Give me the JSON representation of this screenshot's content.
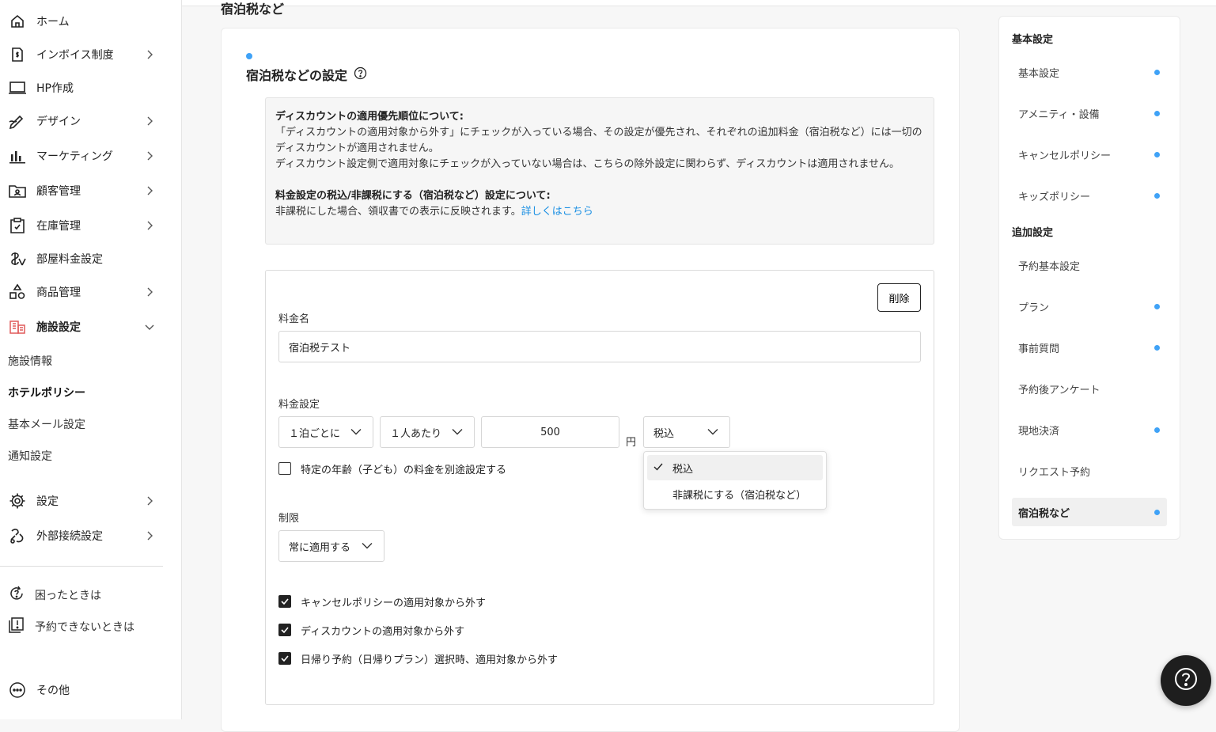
{
  "sidebar": {
    "items": [
      {
        "label": "ホーム",
        "icon": "home-icon",
        "has_chevron": false
      },
      {
        "label": "インボイス制度",
        "icon": "invoice-icon",
        "has_chevron": true
      },
      {
        "label": "HP作成",
        "icon": "laptop-icon",
        "has_chevron": false
      },
      {
        "label": "デザイン",
        "icon": "pen-icon",
        "has_chevron": true
      },
      {
        "label": "マーケティング",
        "icon": "bar-chart-icon",
        "has_chevron": true
      },
      {
        "label": "顧客管理",
        "icon": "folder-user-icon",
        "has_chevron": true
      },
      {
        "label": "在庫管理",
        "icon": "clipboard-check-icon",
        "has_chevron": true
      },
      {
        "label": "部屋料金設定",
        "icon": "yen-icon",
        "has_chevron": false
      },
      {
        "label": "商品管理",
        "icon": "shapes-icon",
        "has_chevron": true
      },
      {
        "label": "施設設定",
        "icon": "building-icon",
        "has_chevron": true,
        "expanded": true
      }
    ],
    "subitems": [
      "施設情報",
      "ホテルポリシー",
      "基本メール設定",
      "通知設定"
    ],
    "settings_items": [
      {
        "label": "設定",
        "icon": "gear-icon"
      },
      {
        "label": "外部接続設定",
        "icon": "link-icon"
      }
    ],
    "help_items": [
      {
        "label": "困ったときは",
        "icon": "help-refresh-icon"
      },
      {
        "label": "予約できないときは",
        "icon": "alert-book-icon"
      }
    ],
    "other_label": "その他"
  },
  "section_heading": "宿泊税など",
  "card": {
    "title": "宿泊税などの設定",
    "info": {
      "heading1": "ディスカウントの適用優先順位について:",
      "line1": "「ディスカウントの適用対象から外す」にチェックが入っている場合、その設定が優先され、それぞれの追加料金（宿泊税など）には一切のディスカウントが適用されません。",
      "line2": "ディスカウント設定側で適用対象にチェックが入っていない場合は、こちらの除外設定に関わらず、ディスカウントは適用されません。",
      "heading2": "料金設定の税込/非課税にする（宿泊税など）設定について:",
      "line3": "非課税にした場合、領収書での表示に反映されます。",
      "link": "詳しくはこちら"
    },
    "fee": {
      "delete_label": "削除",
      "name_label": "料金名",
      "name_value": "宿泊税テスト",
      "price_label": "料金設定",
      "per_night": "１泊ごとに",
      "per_person": "１人あたり",
      "amount": "500",
      "unit": "円",
      "tax": "税込",
      "child_checkbox": "特定の年齢（子ども）の料金を別途設定する",
      "limit_label": "制限",
      "limit_value": "常に適用する",
      "checkboxes": [
        "キャンセルポリシーの適用対象から外す",
        "ディスカウントの適用対象から外す",
        "日帰り予約（日帰りプラン）選択時、適用対象から外す"
      ]
    },
    "tax_dropdown": {
      "options": [
        "税込",
        "非課税にする（宿泊税など）"
      ],
      "selected": "税込"
    }
  },
  "right_panel": {
    "group1": "基本設定",
    "group1_items": [
      {
        "label": "基本設定",
        "dot": true
      },
      {
        "label": "アメニティ・設備",
        "dot": true
      },
      {
        "label": "キャンセルポリシー",
        "dot": true
      },
      {
        "label": "キッズポリシー",
        "dot": true
      }
    ],
    "group2": "追加設定",
    "group2_items": [
      {
        "label": "予約基本設定",
        "dot": false
      },
      {
        "label": "プラン",
        "dot": true
      },
      {
        "label": "事前質問",
        "dot": true
      },
      {
        "label": "予約後アンケート",
        "dot": false
      },
      {
        "label": "現地決済",
        "dot": true
      },
      {
        "label": "リクエスト予約",
        "dot": false
      },
      {
        "label": "宿泊税など",
        "dot": true,
        "active": true
      }
    ]
  },
  "colors": {
    "accent_blue": "#3fa2f7",
    "link_blue": "#1a8fe3",
    "building_icon_red": "#e05a5a"
  }
}
